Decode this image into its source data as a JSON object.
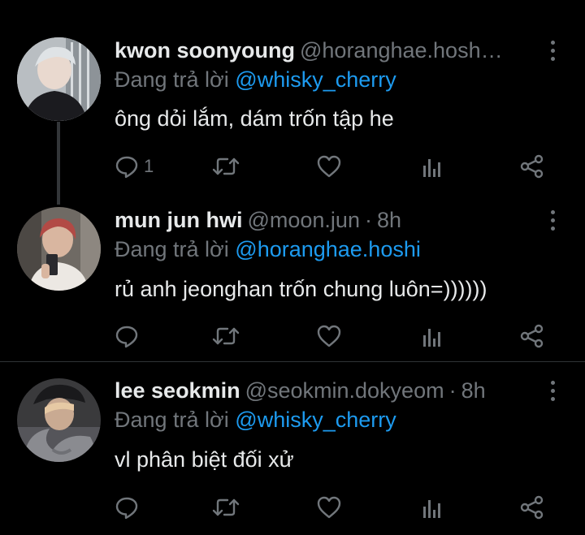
{
  "tweets": [
    {
      "name": "kwon soonyoung",
      "handle": "@horanghae.hosh…",
      "time": "",
      "reply_prefix": "Đang trả lời",
      "reply_to": "@whisky_cherry",
      "text": "ông dỏi lắm, dám trốn tập he",
      "reply_count": "1",
      "avatar": "avatar-silver-hair"
    },
    {
      "name": "mun jun hwi",
      "handle": "@moon.jun",
      "time": "8h",
      "reply_prefix": "Đang trả lời",
      "reply_to": "@horanghae.hoshi",
      "text": "rủ anh jeonghan trốn chung luôn=))))))",
      "reply_count": "",
      "avatar": "avatar-red-hair"
    },
    {
      "name": "lee seokmin",
      "handle": "@seokmin.dokyeom",
      "time": "8h",
      "reply_prefix": "Đang trả lời",
      "reply_to": "@whisky_cherry",
      "text": "vl phân biệt đối xử",
      "reply_count": "",
      "avatar": "avatar-dark-cap"
    }
  ],
  "separator": "·",
  "colors": {
    "background": "#000000",
    "text": "#e7e9ea",
    "muted": "#71767b",
    "accent": "#1d9bf0"
  },
  "icons": [
    "reply-icon",
    "retweet-icon",
    "like-icon",
    "analytics-icon",
    "share-icon",
    "more-icon"
  ]
}
